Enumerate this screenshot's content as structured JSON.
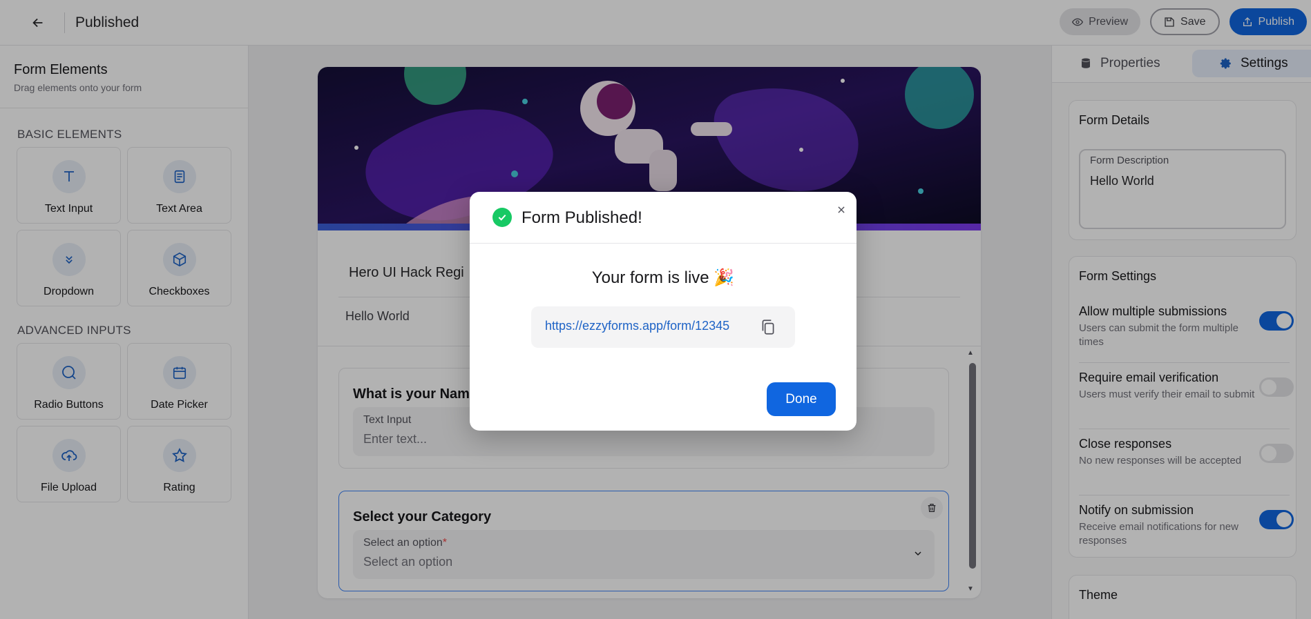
{
  "header": {
    "title": "Published",
    "preview_label": "Preview",
    "save_label": "Save",
    "publish_label": "Publish"
  },
  "left_panel": {
    "title": "Form Elements",
    "subtitle": "Drag elements onto your form",
    "basic_label": "BASIC ELEMENTS",
    "advanced_label": "ADVANCED INPUTS",
    "basic_items": [
      {
        "label": "Text Input",
        "icon": "text-icon"
      },
      {
        "label": "Text Area",
        "icon": "textarea-icon"
      },
      {
        "label": "Dropdown",
        "icon": "chevrons-down-icon"
      },
      {
        "label": "Checkboxes",
        "icon": "box-icon"
      }
    ],
    "advanced_items": [
      {
        "label": "Radio Buttons",
        "icon": "radio-icon"
      },
      {
        "label": "Date Picker",
        "icon": "calendar-icon"
      },
      {
        "label": "File Upload",
        "icon": "cloud-upload-icon"
      },
      {
        "label": "Rating",
        "icon": "star-icon"
      }
    ]
  },
  "form": {
    "title": "Hero UI Hack Regi",
    "description": "Hello World",
    "questions": [
      {
        "title": "What is your Nam",
        "field_label": "Text Input",
        "placeholder": "Enter text..."
      },
      {
        "title": "Select your Category",
        "field_label": "Select an option",
        "required_mark": "*",
        "placeholder": "Select an option"
      }
    ]
  },
  "right_panel": {
    "tabs": [
      "Properties",
      "Settings"
    ],
    "active_tab": "Settings",
    "form_details_title": "Form Details",
    "description_label": "Form Description",
    "description_value": "Hello World",
    "form_settings_title": "Form Settings",
    "settings": [
      {
        "title": "Allow multiple submissions",
        "desc": "Users can submit the form multiple times",
        "on": true
      },
      {
        "title": "Require email verification",
        "desc": "Users must verify their email to submit",
        "on": false
      },
      {
        "title": "Close responses",
        "desc": "No new responses will be accepted",
        "on": false
      },
      {
        "title": "Notify on submission",
        "desc": "Receive email notifications for new responses",
        "on": true
      }
    ],
    "theme_title": "Theme"
  },
  "modal": {
    "title": "Form Published!",
    "live_text": "Your form is live 🎉",
    "url": "https://ezzyforms.app/form/12345",
    "done_label": "Done"
  },
  "colors": {
    "accent": "#1066e0",
    "success": "#17c964",
    "link": "#1e63c6"
  }
}
